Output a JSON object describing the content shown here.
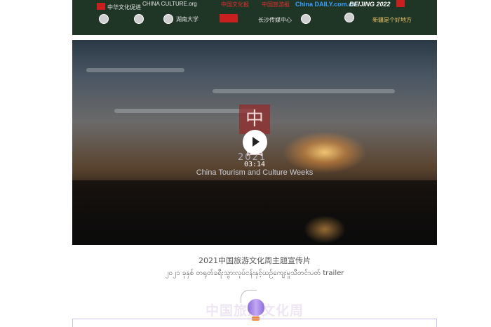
{
  "banner": {
    "logos": [
      "中华文化促进",
      "CHINA CULTURE.org",
      "中国文化报",
      "中国旅游报",
      "China DAILY.com.cn",
      "BEIJING 2022",
      "湖南大学",
      "长沙传媒中心",
      "新疆是个好地方"
    ]
  },
  "video": {
    "badge_text": "中国",
    "year": "2021",
    "title": "China Tourism and Culture Weeks",
    "duration": "03:14"
  },
  "captions": {
    "chinese": "2021中国旅游文化周主题宣传片",
    "myanmar": "၂၀၂၁ ခုနှစ် တရုတ်ခရီးသွားလုပ်ငန်းနှင့်ယဉ်ကျေးမှုသီတင်းပတ် trailer"
  },
  "section": {
    "title": "中国旅游文化周"
  },
  "icons": {
    "play": "play-icon",
    "balloon": "hot-air-balloon-icon"
  }
}
